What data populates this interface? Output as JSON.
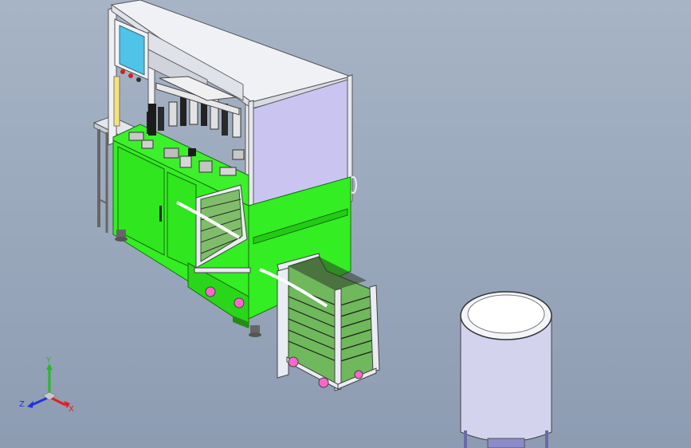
{
  "viewport": {
    "background_top": "#a7b4c6",
    "background_bottom": "#8d9cb2"
  },
  "model": {
    "frame_color": "#e9ecf2",
    "panel_color": "#c9c5f0",
    "base_color": "#33ee22",
    "screen_color": "#4fc3e8",
    "caster_color": "#ff66cc",
    "tank_color": "#d3d3ee"
  },
  "triad": {
    "x_label": "X",
    "y_label": "Y",
    "z_label": "Z",
    "x_color": "#e02020",
    "y_color": "#22bb22",
    "z_color": "#2233dd"
  }
}
